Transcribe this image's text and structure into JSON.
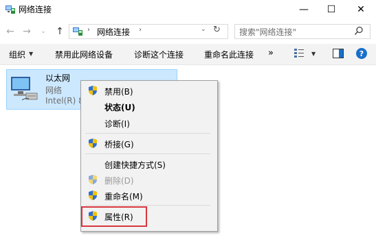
{
  "window": {
    "title": "网络连接",
    "min_glyph": "—",
    "max_glyph": "☐",
    "close_glyph": "✕"
  },
  "nav": {
    "back": "←",
    "forward": "→",
    "recent": "⌄",
    "up": "↑",
    "address_crumb": "网络连接",
    "crumb_sep": "›",
    "dropdown": "⌄",
    "refresh": "↻",
    "search_placeholder": "搜索\"网络连接\""
  },
  "commands": {
    "organize": "组织",
    "organize_caret": "▼",
    "disable_device": "禁用此网络设备",
    "diagnose": "诊断这个连接",
    "rename": "重命名此连接",
    "more": "»",
    "view_caret": "▼",
    "help": "?"
  },
  "adapter": {
    "name": "以太网",
    "status": "网络",
    "device": "Intel(R) 8"
  },
  "context_menu": {
    "items": [
      {
        "label": "禁用(B)",
        "shield": true
      },
      {
        "label": "状态(U)",
        "bold": true
      },
      {
        "label": "诊断(I)"
      },
      {
        "label": "桥接(G)",
        "shield": true
      },
      {
        "label": "创建快捷方式(S)"
      },
      {
        "label": "删除(D)",
        "shield": true,
        "disabled": true
      },
      {
        "label": "重命名(M)",
        "shield": true
      },
      {
        "label": "属性(R)",
        "shield": true,
        "highlighted": true
      }
    ]
  },
  "colors": {
    "selection_fill": "#cce8ff",
    "selection_border": "#99d1ff",
    "highlight_box": "#d9363e",
    "shield_blue": "#2f6fd6",
    "shield_yellow": "#f2c200"
  }
}
